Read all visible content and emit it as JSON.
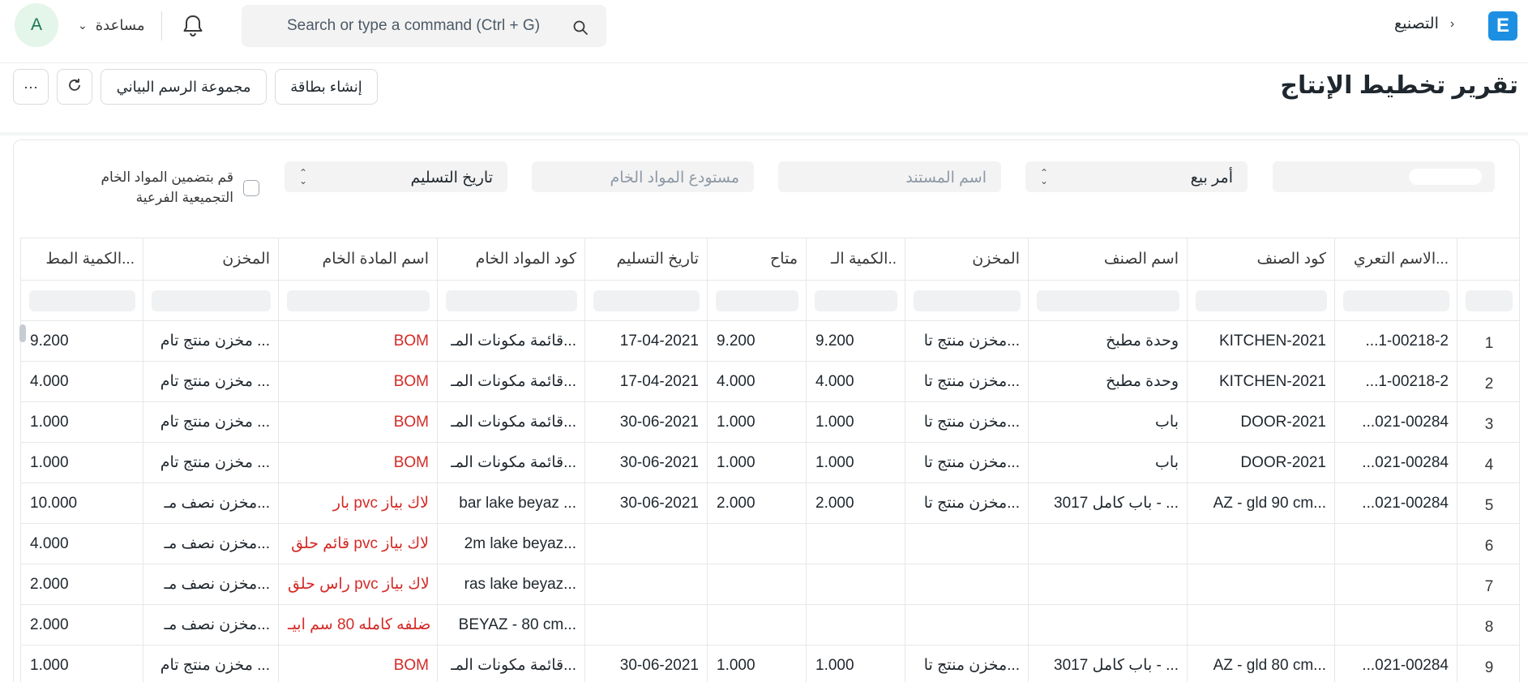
{
  "navbar": {
    "avatar_letter": "A",
    "help_label": "مساعدة",
    "search_placeholder": "Search or type a command (Ctrl + G)",
    "breadcrumb": "التصنيع",
    "logo_letter": "E"
  },
  "page": {
    "title": "تقرير تخطيط الإنتاج",
    "create_card_label": "إنشاء بطاقة",
    "chart_group_label": "مجموعة الرسم البياني",
    "more_label": "···"
  },
  "filters": {
    "based_on": "أمر بيع",
    "document_name_placeholder": "اسم المستند",
    "raw_material_warehouse_placeholder": "مستودع المواد الخام",
    "order_by": "تاريخ التسليم",
    "include_subassembly_label": "قم بتضمين المواد الخام التجميعية الفرعية"
  },
  "table": {
    "headers": [
      "الاسم التعري...",
      "كود الصنف",
      "اسم الصنف",
      "المخزن",
      "الكمية الـ..",
      "متاح",
      "تاريخ التسليم",
      "كود المواد الخام",
      "اسم المادة الخام",
      "المخزن",
      "الكمية المط..."
    ],
    "rows": [
      {
        "n": "1",
        "c": [
          "...1-00218-2",
          "KITCHEN-2021",
          "وحدة مطبخ",
          "مخزن منتج تا...",
          "9.200",
          "9.200",
          "17-04-2021",
          "قائمة مكونات المـ...",
          "BOM",
          "مخزن منتج تام ...",
          "9.200"
        ]
      },
      {
        "n": "2",
        "c": [
          "...1-00218-2",
          "KITCHEN-2021",
          "وحدة مطبخ",
          "مخزن منتج تا...",
          "4.000",
          "4.000",
          "17-04-2021",
          "قائمة مكونات المـ...",
          "BOM",
          "مخزن منتج تام ...",
          "4.000"
        ]
      },
      {
        "n": "3",
        "c": [
          "...021-00284",
          "DOOR-2021",
          "باب",
          "مخزن منتج تا...",
          "1.000",
          "1.000",
          "30-06-2021",
          "قائمة مكونات المـ...",
          "BOM",
          "مخزن منتج تام ...",
          "1.000"
        ]
      },
      {
        "n": "4",
        "c": [
          "...021-00284",
          "DOOR-2021",
          "باب",
          "مخزن منتج تا...",
          "1.000",
          "1.000",
          "30-06-2021",
          "قائمة مكونات المـ...",
          "BOM",
          "مخزن منتج تام ...",
          "1.000"
        ]
      },
      {
        "n": "5",
        "c": [
          "...021-00284",
          "AZ - gld 90 cm...",
          "باب كامل 3017 - ...",
          "مخزن منتج تا...",
          "2.000",
          "2.000",
          "30-06-2021",
          "bar lake beyaz ...",
          "بار pvc لاك بياز",
          "مخزن نصف مـ...",
          "10.000"
        ]
      },
      {
        "n": "6",
        "c": [
          "",
          "",
          "",
          "",
          "",
          "",
          "",
          "2m lake beyaz...",
          "قائم حلق pvc لاك بياز",
          "مخزن نصف مـ...",
          "4.000"
        ]
      },
      {
        "n": "7",
        "c": [
          "",
          "",
          "",
          "",
          "",
          "",
          "",
          "ras lake beyaz...",
          "راس حلق pvc لاك بياز",
          "مخزن نصف مـ...",
          "2.000"
        ]
      },
      {
        "n": "8",
        "c": [
          "",
          "",
          "",
          "",
          "",
          "",
          "",
          "BEYAZ - 80 cm...",
          "ضلفه كامله 80 سم ابيـ",
          "مخزن نصف مـ...",
          "2.000"
        ]
      },
      {
        "n": "9",
        "c": [
          "...021-00284",
          "AZ - gld 80 cm...",
          "باب كامل 3017 - ...",
          "مخزن منتج تا...",
          "1.000",
          "1.000",
          "30-06-2021",
          "قائمة مكونات المـ...",
          "BOM",
          "مخزن منتج تام ...",
          "1.000"
        ]
      }
    ]
  },
  "colors": {
    "link_red": "#d42a26",
    "brand_blue": "#1d8fe3",
    "avatar_green": "#16794c"
  }
}
